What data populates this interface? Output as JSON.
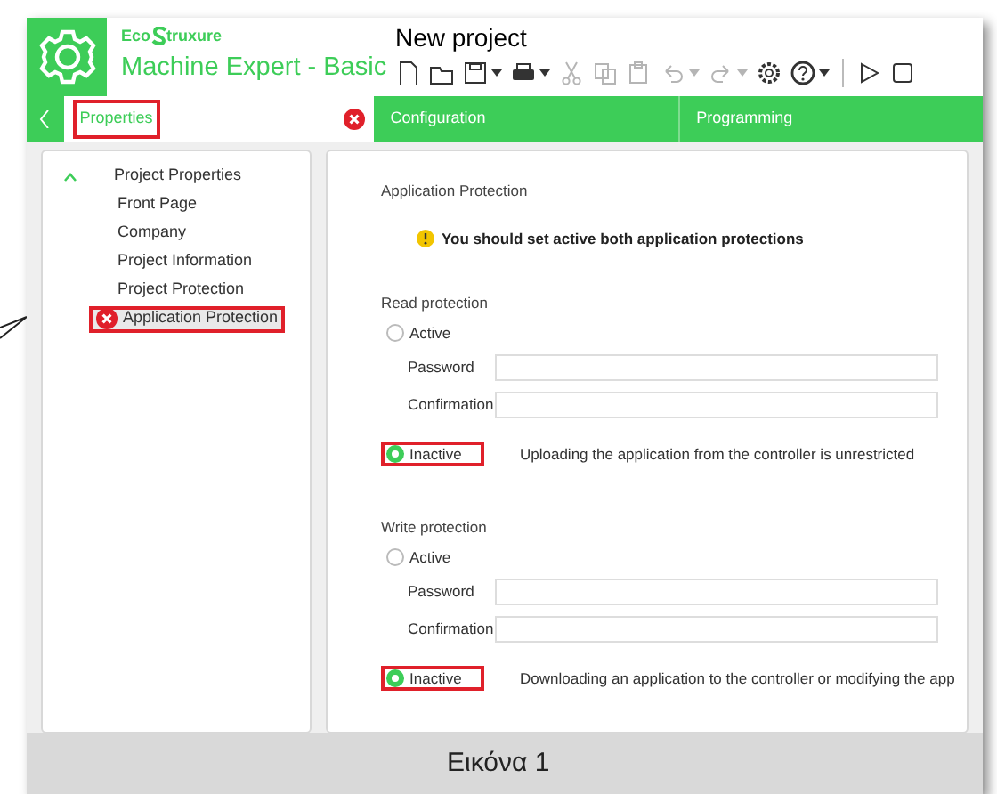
{
  "header": {
    "logo_left": "Eco",
    "logo_right": "truxure",
    "product": "Machine Expert - Basic",
    "project_title": "New project"
  },
  "toolbar": [
    {
      "kind": "new",
      "disabled": false,
      "dropdown": false
    },
    {
      "kind": "open",
      "disabled": false,
      "dropdown": false
    },
    {
      "kind": "save",
      "disabled": false,
      "dropdown": true
    },
    {
      "kind": "print",
      "disabled": false,
      "dropdown": true
    },
    {
      "kind": "cut",
      "disabled": true,
      "dropdown": false
    },
    {
      "kind": "copy",
      "disabled": true,
      "dropdown": false
    },
    {
      "kind": "paste",
      "disabled": true,
      "dropdown": false
    },
    {
      "kind": "undo",
      "disabled": true,
      "dropdown": true
    },
    {
      "kind": "redo",
      "disabled": true,
      "dropdown": true
    },
    {
      "kind": "settings",
      "disabled": false,
      "dropdown": false
    },
    {
      "kind": "help",
      "disabled": false,
      "dropdown": true
    },
    {
      "kind": "separator"
    },
    {
      "kind": "play",
      "disabled": false,
      "dropdown": false
    },
    {
      "kind": "stop",
      "disabled": false,
      "dropdown": false
    }
  ],
  "tabs": [
    {
      "label": "Properties",
      "selected": true,
      "error": true,
      "highlighted": true
    },
    {
      "label": "Configuration",
      "selected": false,
      "error": false,
      "highlighted": false
    },
    {
      "label": "Programming",
      "selected": false,
      "error": false,
      "highlighted": false
    }
  ],
  "tree": [
    {
      "label": "Project Properties",
      "expanded": true,
      "selected": false,
      "error": false,
      "highlighted": false,
      "children": [
        {
          "label": "Front Page",
          "selected": false,
          "error": false,
          "highlighted": false
        },
        {
          "label": "Company",
          "selected": false,
          "error": false,
          "highlighted": false
        },
        {
          "label": "Project Information",
          "selected": false,
          "error": false,
          "highlighted": false
        },
        {
          "label": "Project Protection",
          "selected": false,
          "error": false,
          "highlighted": false
        },
        {
          "label": "Application Protection",
          "selected": true,
          "error": true,
          "highlighted": true
        }
      ]
    }
  ],
  "panel": {
    "title": "Application Protection",
    "warning": "You should set active both application protections",
    "sections": [
      {
        "title": "Read protection",
        "active": {
          "label": "Active",
          "selected": false,
          "highlighted": false
        },
        "password_label": "Password",
        "confirmation_label": "Confirmation",
        "inactive": {
          "label": "Inactive",
          "selected": true,
          "highlighted": true
        },
        "inactive_description": "Uploading the application from the controller is unrestricted"
      },
      {
        "title": "Write protection",
        "active": {
          "label": "Active",
          "selected": false,
          "highlighted": false
        },
        "password_label": "Password",
        "confirmation_label": "Confirmation",
        "inactive": {
          "label": "Inactive",
          "selected": true,
          "highlighted": true
        },
        "inactive_description": "Downloading an application to the controller or modifying the app"
      }
    ]
  },
  "caption": "Εικόνα 1"
}
